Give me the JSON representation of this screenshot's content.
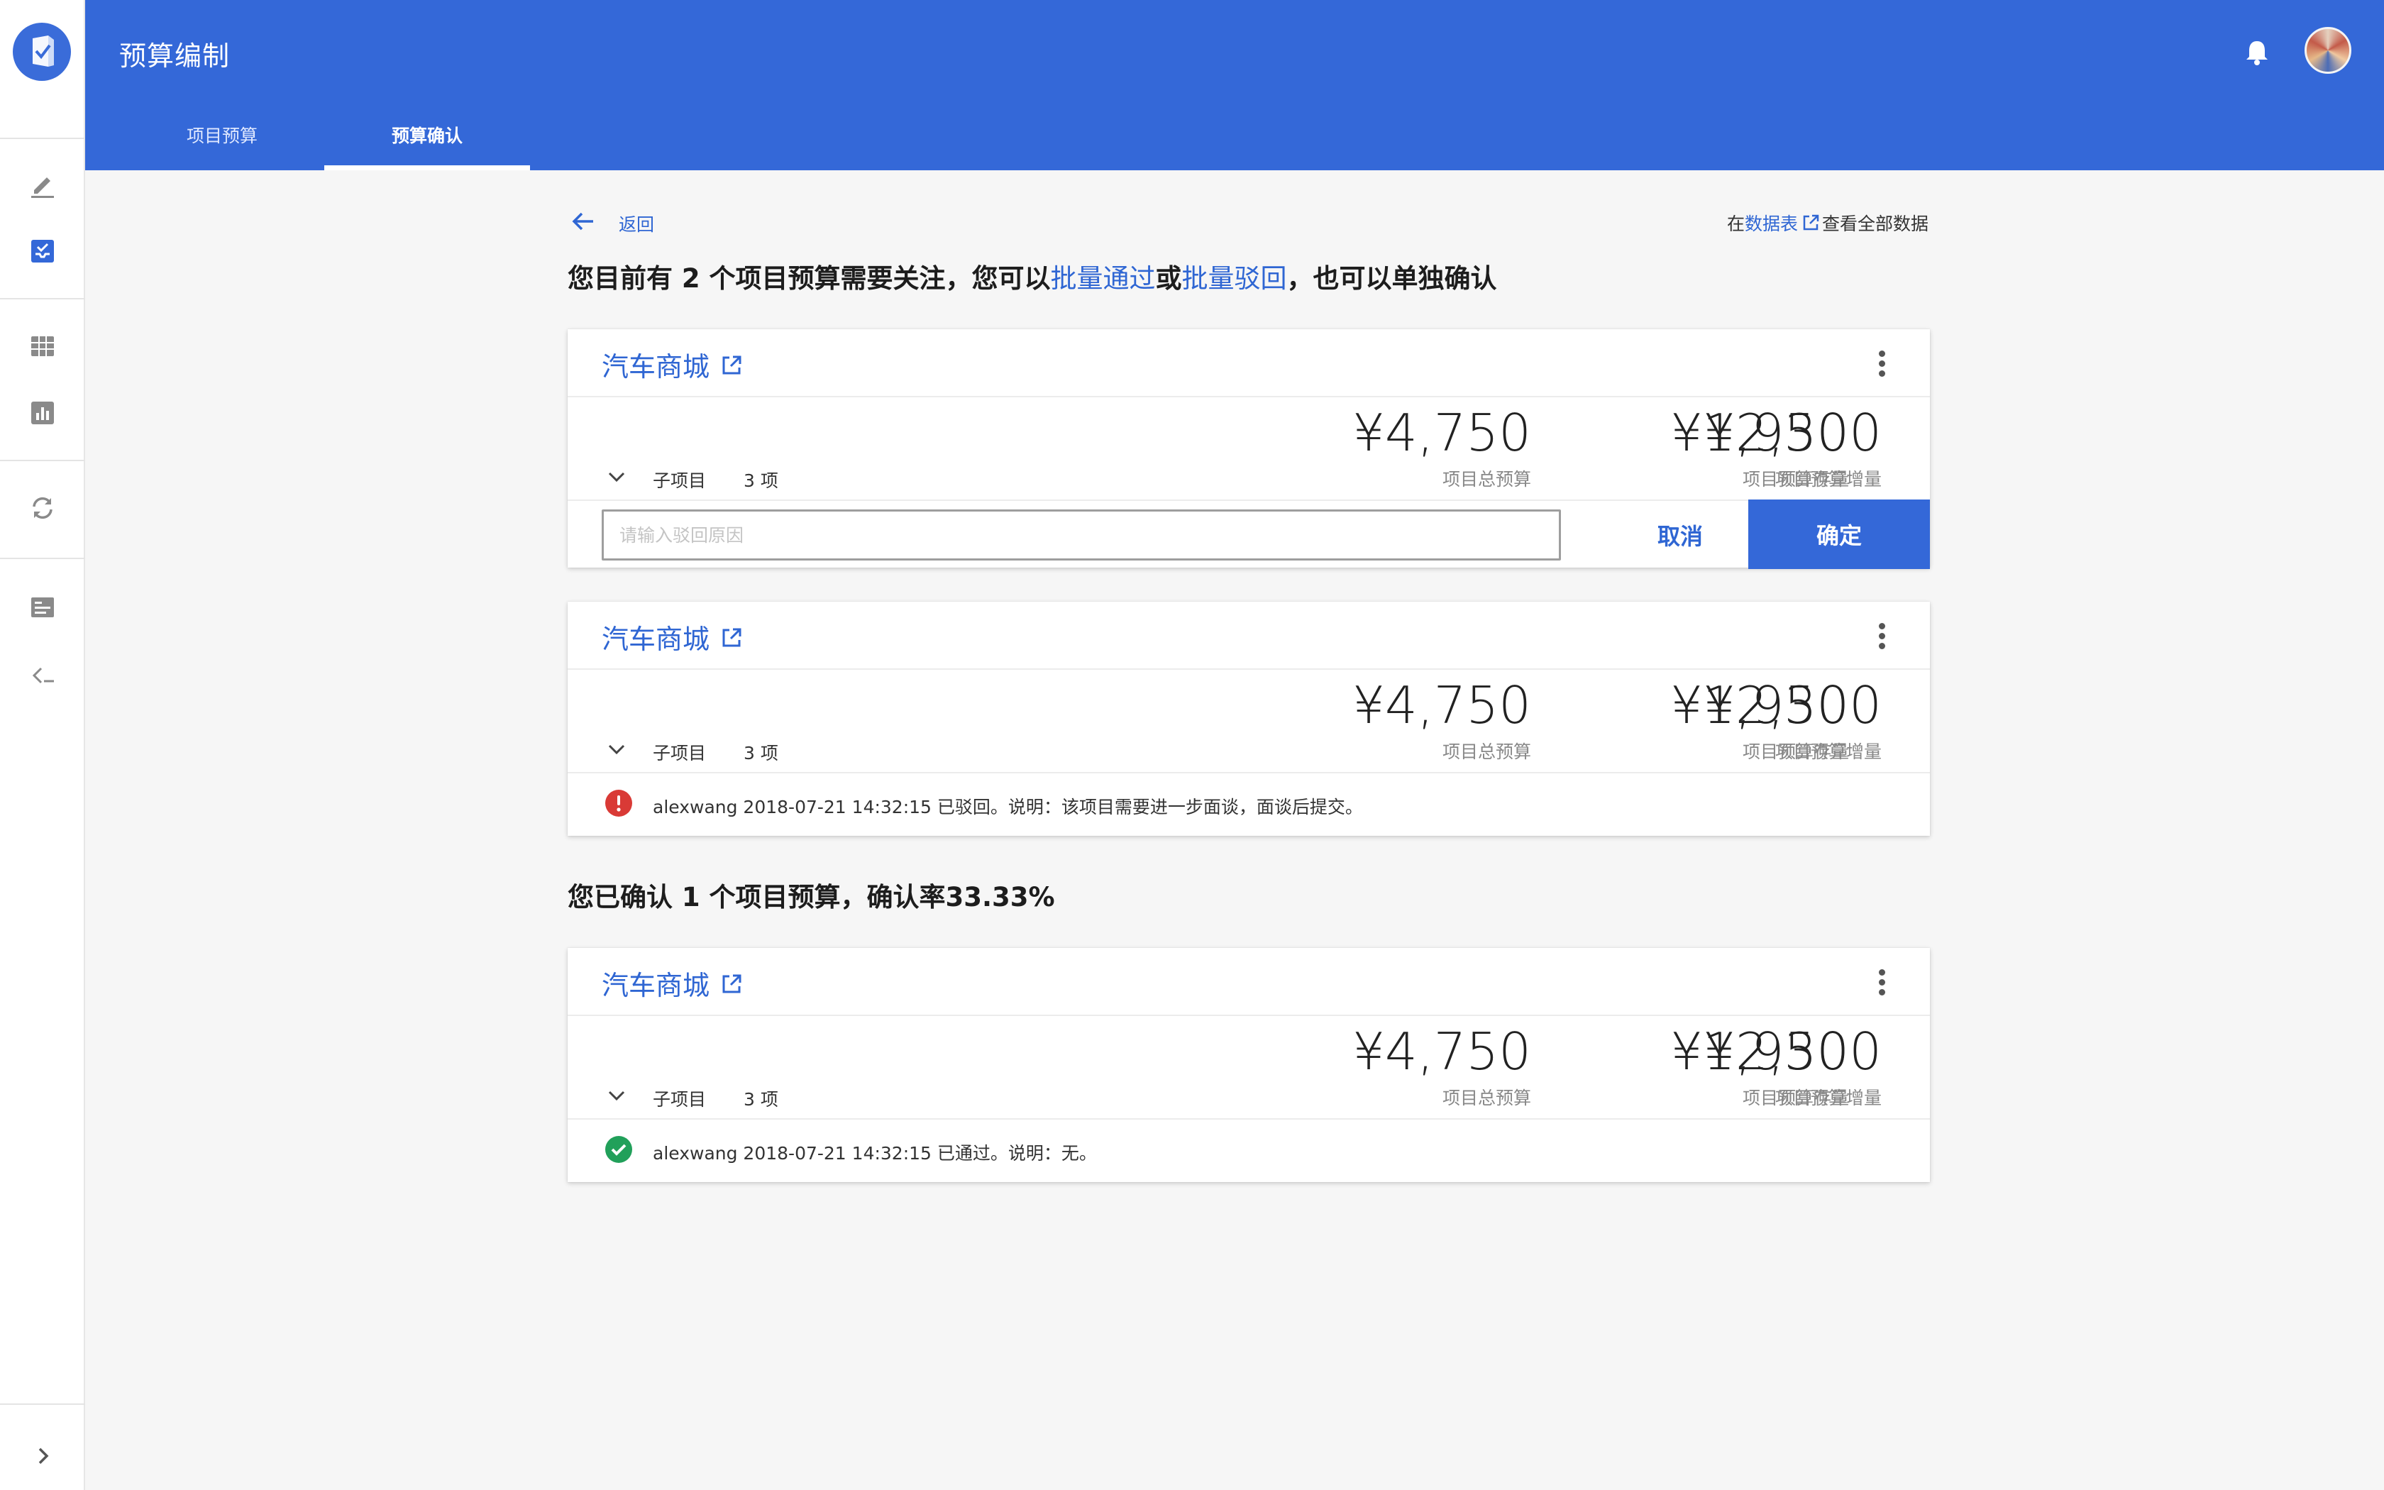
{
  "app": {
    "title": "预算编制",
    "tabs": [
      {
        "label": "项目预算",
        "active": false
      },
      {
        "label": "预算确认",
        "active": true
      }
    ],
    "accent_color": "#3468d8",
    "rail_icons": [
      "pencil-icon",
      "inbox-check-icon",
      "table-grid-icon",
      "bar-chart-icon",
      "sync-icon",
      "list-card-icon",
      "collapse-left-icon",
      "chevron-right-icon"
    ],
    "appbar_icons": [
      "bell-icon",
      "avatar"
    ]
  },
  "nav": {
    "back_label": "返回",
    "sheet_prefix": "在",
    "sheet_link": "数据表",
    "sheet_suffix": "查看全部数据"
  },
  "pending": {
    "heading_pre": "您目前有 2 个项目预算需要关注，您可以",
    "batch_approve": "批量通过",
    "or": "或",
    "batch_reject": "批量驳回",
    "heading_post": "，也可以单独确认"
  },
  "confirmed": {
    "heading": "您已确认 1 个项目预算，确认率33.33%"
  },
  "cards": [
    {
      "title": "汽车商城",
      "sub_label": "子项目",
      "sub_count": "3 项",
      "total": "¥4,750",
      "total_caption": "项目总预算",
      "stock": "¥1,950",
      "stock_caption": "项目预算存量",
      "increment": "¥2,300",
      "increment_caption": "项目预算增量",
      "reject_placeholder": "请输入驳回原因",
      "cancel_label": "取消",
      "confirm_label": "确定"
    },
    {
      "title": "汽车商城",
      "sub_label": "子项目",
      "sub_count": "3 项",
      "total": "¥4,750",
      "total_caption": "项目总预算",
      "stock": "¥1,950",
      "stock_caption": "项目预算存量",
      "increment": "¥2,300",
      "increment_caption": "项目预算增量",
      "status_icon": "error-icon",
      "status_color": "#d93a36",
      "status_text": "alexwang 2018-07-21 14:32:15 已驳回。说明：该项目需要进一步面谈，面谈后提交。"
    },
    {
      "title": "汽车商城",
      "sub_label": "子项目",
      "sub_count": "3 项",
      "total": "¥4,750",
      "total_caption": "项目总预算",
      "stock": "¥1,950",
      "stock_caption": "项目预算存量",
      "increment": "¥2,300",
      "increment_caption": "项目预算增量",
      "status_icon": "check-circle-icon",
      "status_color": "#21a05a",
      "status_text": "alexwang 2018-07-21 14:32:15 已通过。说明：无。"
    }
  ]
}
